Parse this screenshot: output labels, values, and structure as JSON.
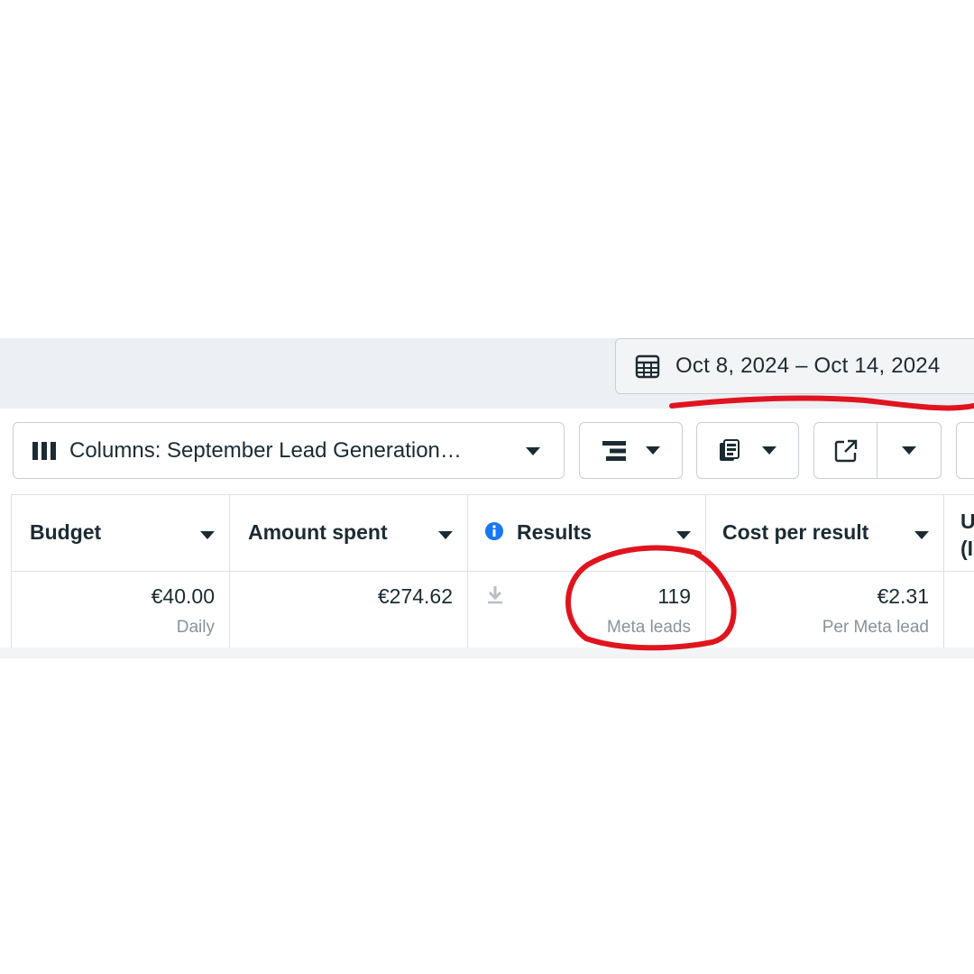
{
  "date_range": {
    "label": "Oct 8, 2024 – Oct 14, 2024",
    "icon": "calendar-icon"
  },
  "toolbar": {
    "columns_label": "Columns: September Lead Generation…",
    "columns_icon": "columns-icon",
    "breakdown_icon": "breakdown-icon",
    "reports_icon": "reports-icon",
    "export_icon": "export-icon"
  },
  "table": {
    "headers": {
      "budget": "Budget",
      "amount_spent": "Amount spent",
      "results": "Results",
      "cost_per_result": "Cost per result",
      "next_col_partial": "U\n(I"
    },
    "row": {
      "budget_value": "€40.00",
      "budget_sub": "Daily",
      "amount_spent_value": "€274.62",
      "results_value": "119",
      "results_sub": "Meta leads",
      "cost_value": "€2.31",
      "cost_sub": "Per Meta lead"
    }
  },
  "colors": {
    "text": "#1c2b33",
    "muted": "#8a9299",
    "info_blue": "#1877f2",
    "annotation_red": "#e0141e",
    "bar_gray": "#eceff3"
  }
}
